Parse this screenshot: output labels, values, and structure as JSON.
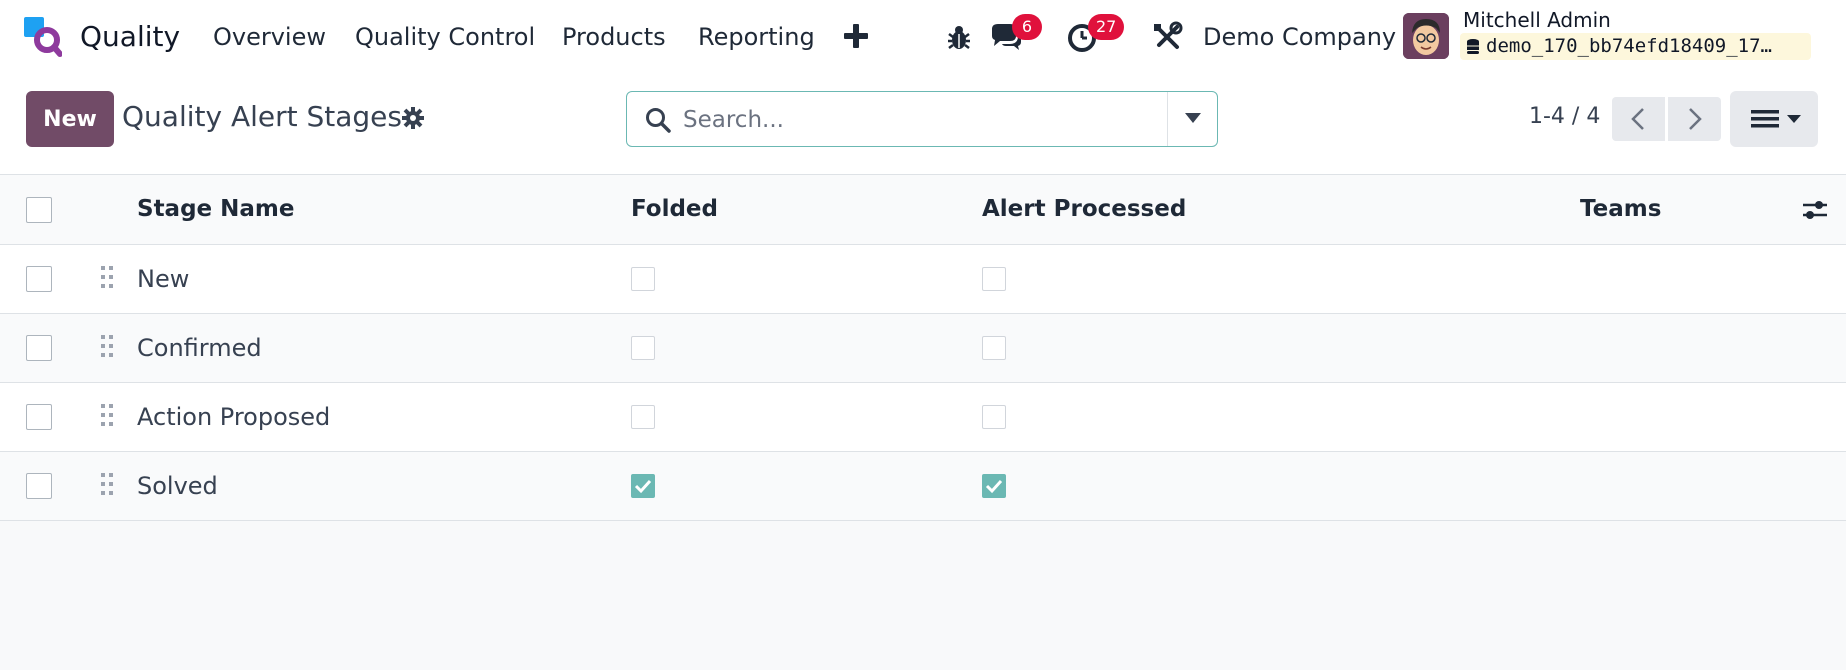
{
  "nav": {
    "app_name": "Quality",
    "menu": [
      "Overview",
      "Quality Control",
      "Products",
      "Reporting"
    ],
    "plus_icon": "plus-icon",
    "debug_icon": "bug-icon",
    "messages_count": "6",
    "activities_count": "27",
    "settings_icon": "tools-icon",
    "company": "Demo Company",
    "user_name": "Mitchell Admin",
    "database": "demo_170_bb74efd18409_17…"
  },
  "control": {
    "new_label": "New",
    "title": "Quality Alert Stages",
    "search_placeholder": "Search...",
    "pager": "1-4 / 4"
  },
  "list": {
    "columns": [
      "Stage Name",
      "Folded",
      "Alert Processed",
      "Teams"
    ],
    "rows": [
      {
        "name": "New",
        "folded": false,
        "alert_processed": false,
        "teams": ""
      },
      {
        "name": "Confirmed",
        "folded": false,
        "alert_processed": false,
        "teams": ""
      },
      {
        "name": "Action Proposed",
        "folded": false,
        "alert_processed": false,
        "teams": ""
      },
      {
        "name": "Solved",
        "folded": true,
        "alert_processed": true,
        "teams": ""
      }
    ]
  },
  "colors": {
    "brand": "#714b67",
    "accent": "#6bb8b3",
    "badge": "#e0113c"
  }
}
